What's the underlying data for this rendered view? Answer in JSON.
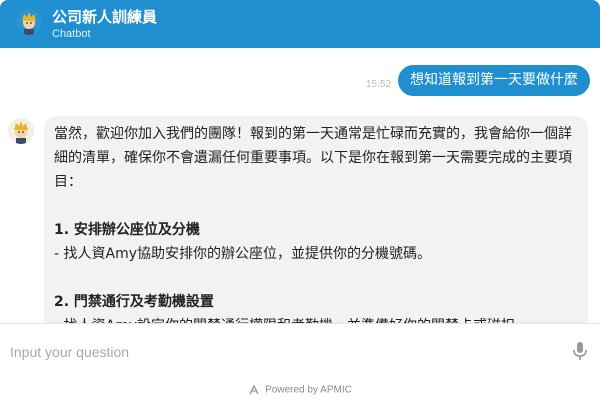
{
  "header": {
    "title": "公司新人訓練員",
    "subtitle": "Chatbot",
    "avatar_icon": "bot-avatar-icon",
    "color": "#1f8fd0"
  },
  "messages": {
    "user": {
      "text": "想知道報到第一天要做什麼",
      "time": "15:52"
    },
    "bot": {
      "intro": "當然，歡迎你加入我們的團隊！報到的第一天通常是忙碌而充實的，我會給你一個詳細的清單，確保你不會遺漏任何重要事項。以下是你在報到第一天需要完成的主要項目：",
      "items": [
        {
          "title": "1. 安排辦公座位及分機",
          "detail": "- 找人資Amy協助安排你的辦公座位，並提供你的分機號碼。"
        },
        {
          "title": "2. 門禁通行及考勤機設置",
          "detail": "- 找人資Amy設定你的門禁通行權限和考勤機，並準備好你的門禁卡或磁扣。"
        }
      ]
    }
  },
  "input": {
    "placeholder": "Input your question",
    "mic_icon": "microphone-icon"
  },
  "footer": {
    "text": "Powered by APMIC",
    "logo_icon": "apmic-logo-icon"
  }
}
